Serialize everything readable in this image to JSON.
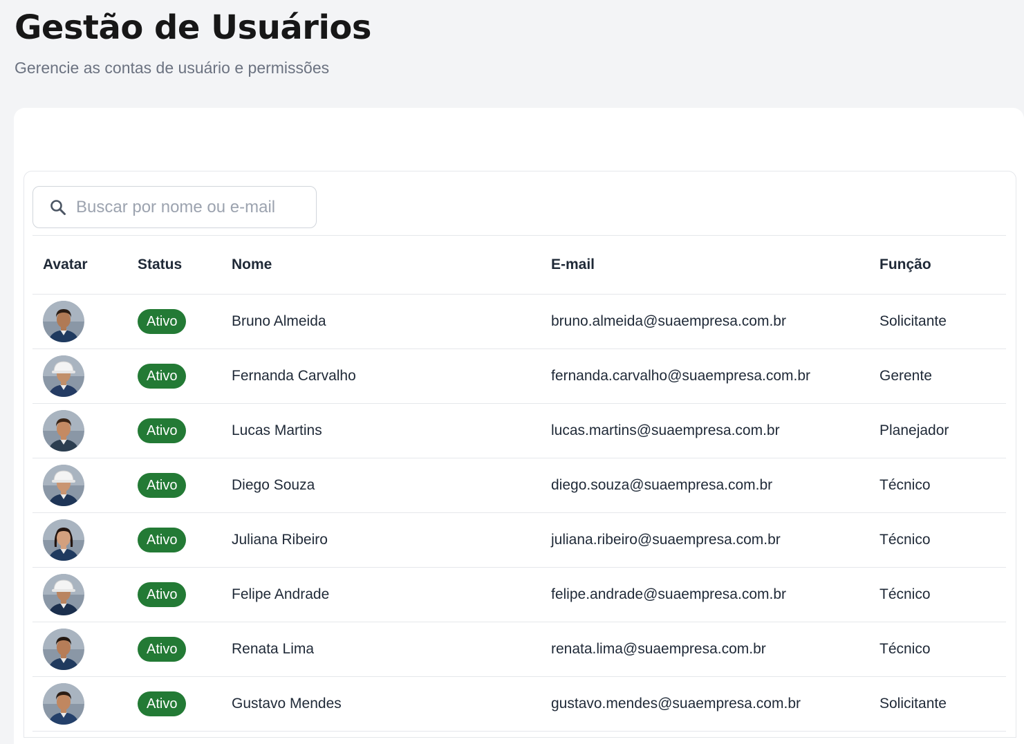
{
  "header": {
    "title": "Gestão de Usuários",
    "subtitle": "Gerencie as contas de usuário e permissões"
  },
  "search": {
    "placeholder": "Buscar por nome ou e-mail",
    "value": "",
    "icon": "search-icon"
  },
  "table": {
    "columns": [
      "Avatar",
      "Status",
      "Nome",
      "E-mail",
      "Função"
    ],
    "status_color": "#237a35",
    "rows": [
      {
        "status": "Ativo",
        "name": "Bruno Almeida",
        "email": "bruno.almeida@suaempresa.com.br",
        "role": "Solicitante",
        "avatar": {
          "skin": "#b07a55",
          "hair": "#2b1d14",
          "shirt": "#1f3a5f",
          "helmet": false,
          "long_hair": false
        }
      },
      {
        "status": "Ativo",
        "name": "Fernanda Carvalho",
        "email": "fernanda.carvalho@suaempresa.com.br",
        "role": "Gerente",
        "avatar": {
          "skin": "#c18f6a",
          "hair": "#2b1d14",
          "shirt": "#243b63",
          "helmet": true,
          "long_hair": false
        }
      },
      {
        "status": "Ativo",
        "name": "Lucas Martins",
        "email": "lucas.martins@suaempresa.com.br",
        "role": "Planejador",
        "avatar": {
          "skin": "#c48a63",
          "hair": "#3a2416",
          "shirt": "#2c3e50",
          "helmet": false,
          "long_hair": false
        }
      },
      {
        "status": "Ativo",
        "name": "Diego Souza",
        "email": "diego.souza@suaempresa.com.br",
        "role": "Técnico",
        "avatar": {
          "skin": "#c99572",
          "hair": "#2b1d14",
          "shirt": "#1e3557",
          "helmet": true,
          "long_hair": false
        }
      },
      {
        "status": "Ativo",
        "name": "Juliana Ribeiro",
        "email": "juliana.ribeiro@suaempresa.com.br",
        "role": "Técnico",
        "avatar": {
          "skin": "#d3a07e",
          "hair": "#231510",
          "shirt": "#1f3a5f",
          "helmet": false,
          "long_hair": true
        }
      },
      {
        "status": "Ativo",
        "name": "Felipe Andrade",
        "email": "felipe.andrade@suaempresa.com.br",
        "role": "Técnico",
        "avatar": {
          "skin": "#b98460",
          "hair": "#2b1d14",
          "shirt": "#1b2f4d",
          "helmet": true,
          "long_hair": false
        }
      },
      {
        "status": "Ativo",
        "name": "Renata Lima",
        "email": "renata.lima@suaempresa.com.br",
        "role": "Técnico",
        "avatar": {
          "skin": "#b67d58",
          "hair": "#241810",
          "shirt": "#203a5e",
          "helmet": false,
          "long_hair": false
        }
      },
      {
        "status": "Ativo",
        "name": "Gustavo Mendes",
        "email": "gustavo.mendes@suaempresa.com.br",
        "role": "Solicitante",
        "avatar": {
          "skin": "#c08760",
          "hair": "#2b1d14",
          "shirt": "#24406a",
          "helmet": false,
          "long_hair": false
        }
      }
    ]
  }
}
